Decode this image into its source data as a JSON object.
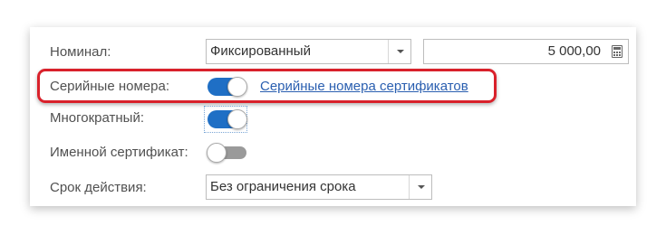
{
  "form": {
    "denomination": {
      "label": "Номинал:",
      "type_value": "Фиксированный",
      "amount_value": "5 000,00"
    },
    "serial_numbers": {
      "label": "Серийные номера:",
      "enabled": true,
      "link_text": "Серийные номера сертификатов"
    },
    "reusable": {
      "label": "Многократный:",
      "enabled": true
    },
    "named_certificate": {
      "label": "Именной сертификат:",
      "enabled": false
    },
    "validity_period": {
      "label": "Срок действия:",
      "value": "Без ограничения срока"
    }
  },
  "colors": {
    "accent": "#1f6fc5",
    "highlight": "#d9212b",
    "link": "#2a5fb0"
  },
  "icons": {
    "dropdown": "chevron-down-icon",
    "calculator": "calculator-icon"
  }
}
